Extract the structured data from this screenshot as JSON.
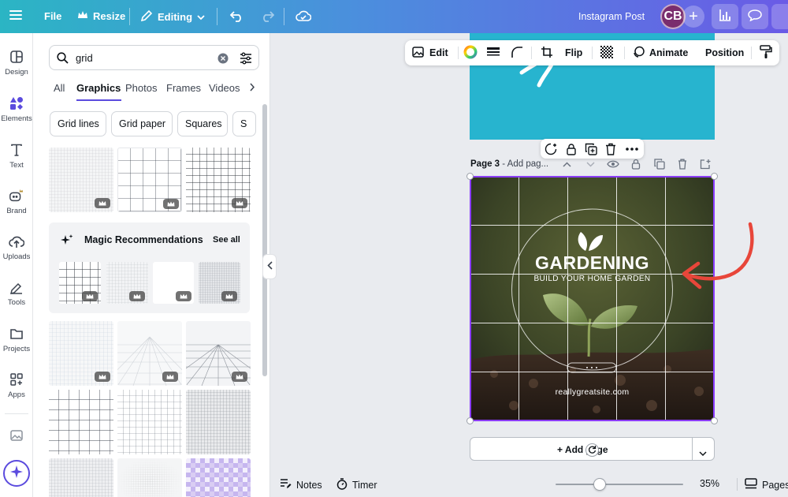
{
  "topbar": {
    "menu_icon": "hamburger-menu-icon",
    "file": "File",
    "resize": "Resize",
    "editing": "Editing",
    "doc_type": "Instagram Post",
    "avatar_initials": "CB",
    "gradient": [
      "#2bb5c4",
      "#4b8fdd",
      "#6a5be6"
    ]
  },
  "rail": {
    "items": [
      {
        "label": "Design",
        "icon": "layout-icon"
      },
      {
        "label": "Elements",
        "icon": "shapes-icon"
      },
      {
        "label": "Text",
        "icon": "text-icon"
      },
      {
        "label": "Brand",
        "icon": "brand-icon"
      },
      {
        "label": "Uploads",
        "icon": "cloud-upload-icon"
      },
      {
        "label": "Tools",
        "icon": "pen-icon"
      },
      {
        "label": "Projects",
        "icon": "folder-icon"
      },
      {
        "label": "Apps",
        "icon": "apps-icon"
      }
    ]
  },
  "panel": {
    "search_value": "grid",
    "tabs": [
      "All",
      "Graphics",
      "Photos",
      "Frames",
      "Videos"
    ],
    "active_tab": "Graphics",
    "chips": [
      "Grid lines",
      "Grid paper",
      "Squares",
      "S"
    ],
    "magic_title": "Magic Recommendations",
    "see_all": "See all"
  },
  "toolbar": {
    "edit": "Edit",
    "flip": "Flip",
    "animate": "Animate",
    "position": "Position"
  },
  "page": {
    "label": "Page 3",
    "title_placeholder": "Add pag..."
  },
  "design": {
    "title": "GARDENING",
    "subtitle": "BUILD YOUR HOME GARDEN",
    "url": "reallygreatsite.com",
    "selection_color": "#8b3dff",
    "arrow_color": "#e8463a"
  },
  "add_page": "+ Add page",
  "bottom": {
    "notes": "Notes",
    "timer": "Timer",
    "zoom": "35%",
    "pages": "Pages"
  }
}
